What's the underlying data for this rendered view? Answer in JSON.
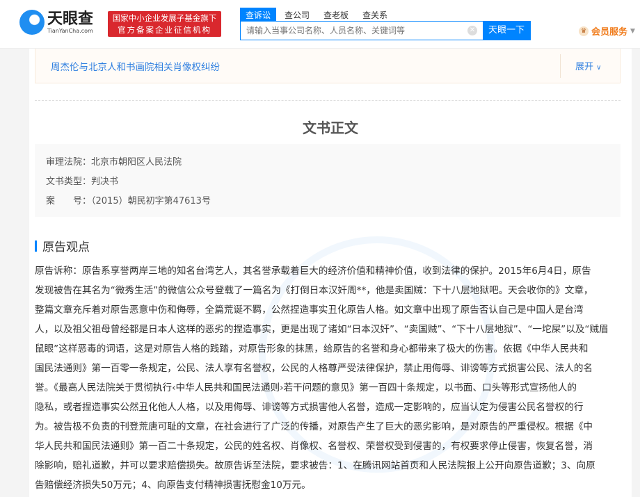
{
  "header": {
    "logo_cn": "天眼查",
    "logo_en": "TianYanCha.com",
    "badge_line1": "国家中小企业发展子基金旗下",
    "badge_line2": "官方备案企业征信机构",
    "tabs": [
      {
        "label": "查诉讼"
      },
      {
        "label": "查公司"
      },
      {
        "label": "查老板"
      },
      {
        "label": "查关系"
      }
    ],
    "search_placeholder": "请输入当事公司名称、人员名称、关键词等",
    "search_button": "天眼一下",
    "member": "会员服务"
  },
  "case_fold": {
    "title": "周杰伦与北京人和书画院相关肖像权纠纷",
    "expand": "展开"
  },
  "document": {
    "title": "文书正文",
    "info": [
      {
        "label": "审理法院：",
        "value": "北京市朝阳区人民法院"
      },
      {
        "label": "文书类型：",
        "value": "判决书"
      },
      {
        "label": "案　　号：",
        "value": "（2015）朝民初字第47613号"
      }
    ],
    "section_title": "原告观点",
    "body_lines": [
      "原告诉称：原告系享誉两岸三地的知名台湾艺人，其名誉承载着巨大的经济价值和精神价值，收到法律的保护。2015年6月4日，原告",
      "发现被告在其名为“微秀生活”的微信公众号登载了一篇名为《打倒日本汉奸周**，他是卖国贼：下十八层地狱吧。天会收你的》文章，",
      "整篇文章充斥着对原告恶意中伤和侮辱，全篇荒诞不羁，公然捏造事实丑化原告人格。如文章中出现了原告否认自己是中国人是台湾",
      "人，以及祖父祖母曾经都是日本人这样的恶劣的捏造事实，更是出现了诸如“日本汉奸”、“卖国贼”、“下十八层地狱”、“一坨屎”以及“贼眉",
      "鼠眼”这样恶毒的词语，这是对原告人格的践踏，对原告形象的抹黑，给原告的名誉和身心都带来了极大的伤害。依据《中华人民共和",
      "国民法通则》第一百零一条规定，公民、法人享有名誉权，公民的人格尊严受法律保护，禁止用侮辱、诽谤等方式损害公民、法人的名",
      "誉。《最高人民法院关于贯彻执行‹中华人民共和国民法通则›若干问题的意见》第一百四十条规定，以书面、口头等形式宣扬他人的",
      "隐私，或者捏造事实公然丑化他人人格，以及用侮辱、诽谤等方式损害他人名誉，造成一定影响的，应当认定为侵害公民名誉权的行",
      "为。被告极不负责的刊登荒唐可耻的文章，在社会进行了广泛的传播，对原告产生了巨大的恶劣影响，是对原告的严重侵权。根据《中",
      "华人民共和国民法通则》第一百二十条规定，公民的姓名权、肖像权、名誉权、荣誉权受到侵害的，有权要求停止侵害，恢复名誉，消",
      "除影响，赔礼道歉，并可以要求赔偿损失。故原告诉至法院，要求被告：1、在腾讯网站首页和人民法院报上公开向原告道歉；3、向原",
      "告赔偿经济损失50万元；4、向原告支付精神损害抚慰金10万元。"
    ]
  }
}
